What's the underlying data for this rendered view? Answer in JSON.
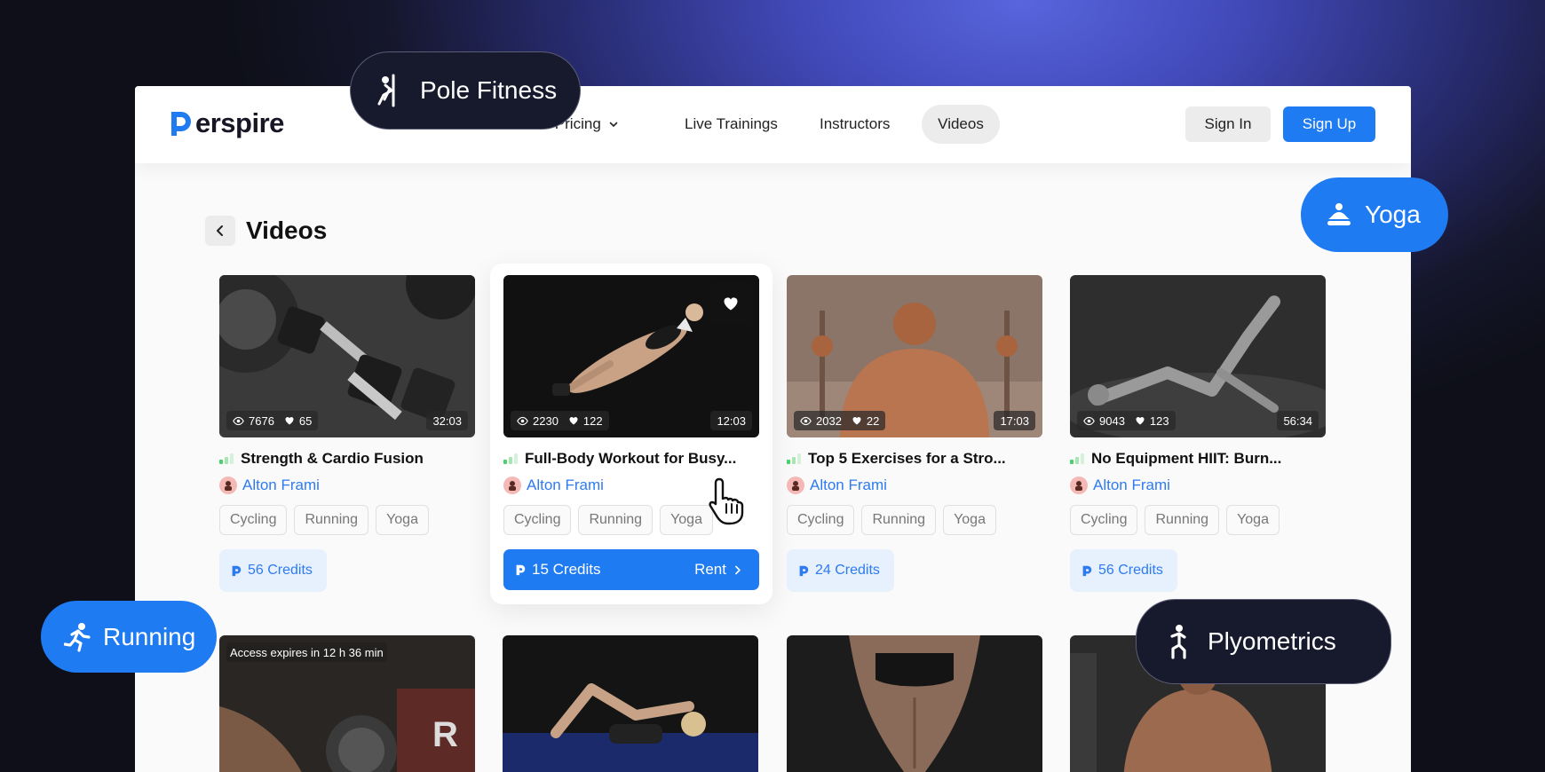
{
  "colors": {
    "accent": "#1f7bf2",
    "link": "#2d7bf0",
    "chip_dark": "#171a2c"
  },
  "brand": {
    "name_rest": "erspire",
    "full_name": "Perspire"
  },
  "nav": {
    "pricing": "Plan & Pricing",
    "live": "Live Trainings",
    "instructors": "Instructors",
    "videos": "Videos",
    "sign_in": "Sign In",
    "sign_up": "Sign Up"
  },
  "page": {
    "title": "Videos"
  },
  "cards": [
    {
      "title": "Strength & Cardio Fusion",
      "views": "7676",
      "likes": "65",
      "duration": "32:03",
      "author": "Alton Frami",
      "tags": [
        "Cycling",
        "Running",
        "Yoga"
      ],
      "credits": "56 Credits"
    },
    {
      "title": "Full-Body Workout for Busy...",
      "views": "2230",
      "likes": "122",
      "duration": "12:03",
      "author": "Alton Frami",
      "tags": [
        "Cycling",
        "Running",
        "Yoga"
      ],
      "credits": "15 Credits",
      "rent": "Rent"
    },
    {
      "title": "Top 5 Exercises for a Stro...",
      "views": "2032",
      "likes": "22",
      "duration": "17:03",
      "author": "Alton Frami",
      "tags": [
        "Cycling",
        "Running",
        "Yoga"
      ],
      "credits": "24 Credits"
    },
    {
      "title": "No Equipment HIIT: Burn...",
      "views": "9043",
      "likes": "123",
      "duration": "56:34",
      "author": "Alton Frami",
      "tags": [
        "Cycling",
        "Running",
        "Yoga"
      ],
      "credits": "56 Credits"
    }
  ],
  "second_row": {
    "access": "Access expires in 12 h 36 min"
  },
  "chips": {
    "pole": "Pole Fitness",
    "yoga": "Yoga",
    "running": "Running",
    "plyo": "Plyometrics"
  }
}
